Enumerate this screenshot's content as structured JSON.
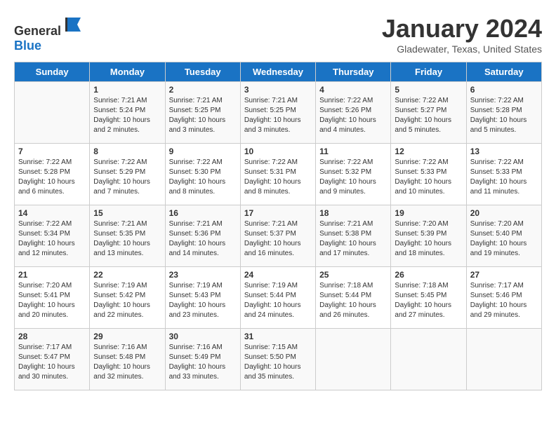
{
  "header": {
    "logo_general": "General",
    "logo_blue": "Blue",
    "month": "January 2024",
    "location": "Gladewater, Texas, United States"
  },
  "days_of_week": [
    "Sunday",
    "Monday",
    "Tuesday",
    "Wednesday",
    "Thursday",
    "Friday",
    "Saturday"
  ],
  "weeks": [
    [
      {
        "day": "",
        "info": ""
      },
      {
        "day": "1",
        "info": "Sunrise: 7:21 AM\nSunset: 5:24 PM\nDaylight: 10 hours\nand 2 minutes."
      },
      {
        "day": "2",
        "info": "Sunrise: 7:21 AM\nSunset: 5:25 PM\nDaylight: 10 hours\nand 3 minutes."
      },
      {
        "day": "3",
        "info": "Sunrise: 7:21 AM\nSunset: 5:25 PM\nDaylight: 10 hours\nand 3 minutes."
      },
      {
        "day": "4",
        "info": "Sunrise: 7:22 AM\nSunset: 5:26 PM\nDaylight: 10 hours\nand 4 minutes."
      },
      {
        "day": "5",
        "info": "Sunrise: 7:22 AM\nSunset: 5:27 PM\nDaylight: 10 hours\nand 5 minutes."
      },
      {
        "day": "6",
        "info": "Sunrise: 7:22 AM\nSunset: 5:28 PM\nDaylight: 10 hours\nand 5 minutes."
      }
    ],
    [
      {
        "day": "7",
        "info": "Sunrise: 7:22 AM\nSunset: 5:28 PM\nDaylight: 10 hours\nand 6 minutes."
      },
      {
        "day": "8",
        "info": "Sunrise: 7:22 AM\nSunset: 5:29 PM\nDaylight: 10 hours\nand 7 minutes."
      },
      {
        "day": "9",
        "info": "Sunrise: 7:22 AM\nSunset: 5:30 PM\nDaylight: 10 hours\nand 8 minutes."
      },
      {
        "day": "10",
        "info": "Sunrise: 7:22 AM\nSunset: 5:31 PM\nDaylight: 10 hours\nand 8 minutes."
      },
      {
        "day": "11",
        "info": "Sunrise: 7:22 AM\nSunset: 5:32 PM\nDaylight: 10 hours\nand 9 minutes."
      },
      {
        "day": "12",
        "info": "Sunrise: 7:22 AM\nSunset: 5:33 PM\nDaylight: 10 hours\nand 10 minutes."
      },
      {
        "day": "13",
        "info": "Sunrise: 7:22 AM\nSunset: 5:33 PM\nDaylight: 10 hours\nand 11 minutes."
      }
    ],
    [
      {
        "day": "14",
        "info": "Sunrise: 7:22 AM\nSunset: 5:34 PM\nDaylight: 10 hours\nand 12 minutes."
      },
      {
        "day": "15",
        "info": "Sunrise: 7:21 AM\nSunset: 5:35 PM\nDaylight: 10 hours\nand 13 minutes."
      },
      {
        "day": "16",
        "info": "Sunrise: 7:21 AM\nSunset: 5:36 PM\nDaylight: 10 hours\nand 14 minutes."
      },
      {
        "day": "17",
        "info": "Sunrise: 7:21 AM\nSunset: 5:37 PM\nDaylight: 10 hours\nand 16 minutes."
      },
      {
        "day": "18",
        "info": "Sunrise: 7:21 AM\nSunset: 5:38 PM\nDaylight: 10 hours\nand 17 minutes."
      },
      {
        "day": "19",
        "info": "Sunrise: 7:20 AM\nSunset: 5:39 PM\nDaylight: 10 hours\nand 18 minutes."
      },
      {
        "day": "20",
        "info": "Sunrise: 7:20 AM\nSunset: 5:40 PM\nDaylight: 10 hours\nand 19 minutes."
      }
    ],
    [
      {
        "day": "21",
        "info": "Sunrise: 7:20 AM\nSunset: 5:41 PM\nDaylight: 10 hours\nand 20 minutes."
      },
      {
        "day": "22",
        "info": "Sunrise: 7:19 AM\nSunset: 5:42 PM\nDaylight: 10 hours\nand 22 minutes."
      },
      {
        "day": "23",
        "info": "Sunrise: 7:19 AM\nSunset: 5:43 PM\nDaylight: 10 hours\nand 23 minutes."
      },
      {
        "day": "24",
        "info": "Sunrise: 7:19 AM\nSunset: 5:44 PM\nDaylight: 10 hours\nand 24 minutes."
      },
      {
        "day": "25",
        "info": "Sunrise: 7:18 AM\nSunset: 5:44 PM\nDaylight: 10 hours\nand 26 minutes."
      },
      {
        "day": "26",
        "info": "Sunrise: 7:18 AM\nSunset: 5:45 PM\nDaylight: 10 hours\nand 27 minutes."
      },
      {
        "day": "27",
        "info": "Sunrise: 7:17 AM\nSunset: 5:46 PM\nDaylight: 10 hours\nand 29 minutes."
      }
    ],
    [
      {
        "day": "28",
        "info": "Sunrise: 7:17 AM\nSunset: 5:47 PM\nDaylight: 10 hours\nand 30 minutes."
      },
      {
        "day": "29",
        "info": "Sunrise: 7:16 AM\nSunset: 5:48 PM\nDaylight: 10 hours\nand 32 minutes."
      },
      {
        "day": "30",
        "info": "Sunrise: 7:16 AM\nSunset: 5:49 PM\nDaylight: 10 hours\nand 33 minutes."
      },
      {
        "day": "31",
        "info": "Sunrise: 7:15 AM\nSunset: 5:50 PM\nDaylight: 10 hours\nand 35 minutes."
      },
      {
        "day": "",
        "info": ""
      },
      {
        "day": "",
        "info": ""
      },
      {
        "day": "",
        "info": ""
      }
    ]
  ]
}
